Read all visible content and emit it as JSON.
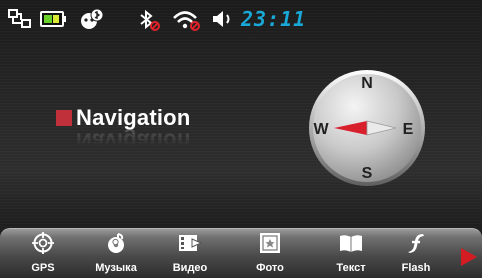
{
  "status_bar": {
    "icons": [
      "usb-connection-icon",
      "battery-icon",
      "bluetooth-headset-icon",
      "bluetooth-off-icon",
      "wifi-off-icon",
      "volume-icon"
    ],
    "clock": "23:11",
    "clock_color": "#19a9d8"
  },
  "main": {
    "title": "Navigation",
    "accent_color": "#c0303a"
  },
  "compass": {
    "north": "N",
    "east": "E",
    "south": "S",
    "west": "W",
    "needle_color": "#d8202c"
  },
  "dock": {
    "items": [
      {
        "label": "GPS",
        "icon": "crosshair-icon"
      },
      {
        "label": "Музыка",
        "icon": "music-icon"
      },
      {
        "label": "Видео",
        "icon": "film-icon"
      },
      {
        "label": "Фото",
        "icon": "photo-icon"
      },
      {
        "label": "Текст",
        "icon": "book-icon"
      },
      {
        "label": "Flash",
        "icon": "flash-icon"
      }
    ],
    "next_arrow_color": "#d41d22"
  }
}
